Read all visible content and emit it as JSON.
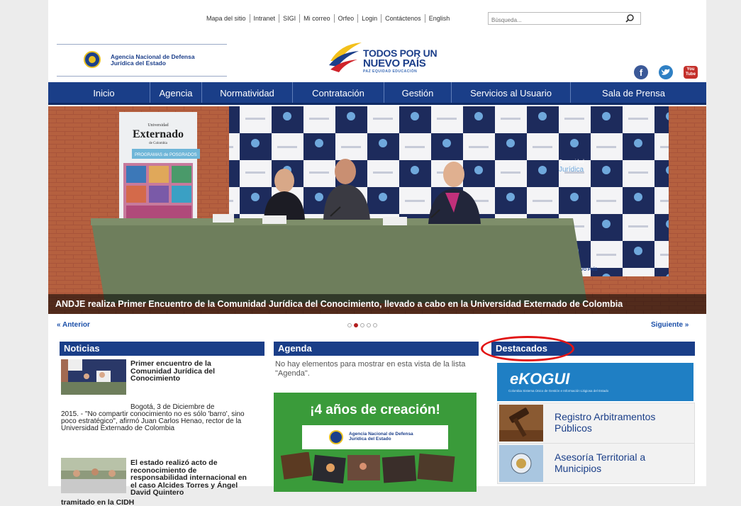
{
  "top_links": [
    "Mapa del sitio",
    "Intranet",
    "SIGI",
    "Mi correo",
    "Orfeo",
    "Login",
    "Contáctenos",
    "English"
  ],
  "search": {
    "placeholder": "Búsqueda..."
  },
  "logo": {
    "line1": "Agencia Nacional de Defensa",
    "line2": "Jurídica del Estado"
  },
  "gov_brand": {
    "line1": "TODOS POR UN",
    "line2": "NUEVO PAÍS",
    "tagline": "PAZ  EQUIDAD  EDUCACIÓN"
  },
  "social": {
    "facebook": "f",
    "twitter": "t",
    "youtube_line1": "You",
    "youtube_line2": "Tube"
  },
  "nav": [
    "Inicio",
    "Agencia",
    "Normatividad",
    "Contratación",
    "Gestión",
    "Servicios al Usuario",
    "Sala de Prensa"
  ],
  "hero": {
    "caption": "ANDJE realiza Primer Encuentro de la Comunidad Jurídica del Conocimiento, llevado a cabo en la Universidad Externado de Colombia",
    "banner_small": "Universidad",
    "banner_big": "Externado",
    "banner_sub": "de Colombia",
    "banner_prog": "PROGRAMAS de POSGRADOS",
    "backdrop_brand": "Comunidad",
    "backdrop_brand2": "Jurídica",
    "backdrop_tpun": "TODOS POR UN NUEVO PAÍS"
  },
  "slider": {
    "prev": "Anterior",
    "next": "Siguiente",
    "dot_count": 5,
    "active_index": 1
  },
  "noticias": {
    "heading": "Noticias",
    "items": [
      {
        "title": "Primer encuentro de la Comunidad Jurídica del Conocimiento",
        "date": "Bogotá, 3 de Diciembre de",
        "body": "2015. - \"No compartir conocimiento no es sólo 'barro', sino poco estratégico\", afirmó Juan Carlos Henao, rector de la Universidad Externado de Colombia"
      },
      {
        "title": "El estado realizó acto de reconocimiento de responsabilidad internacional en el caso Alcides Torres y Ángel David Quintero",
        "body": "tramitado en la CIDH"
      }
    ]
  },
  "agenda": {
    "heading": "Agenda",
    "empty_message": "No hay elementos para mostrar en esta vista de la lista \"Agenda\".",
    "promo_title": "¡4 años de creación!",
    "promo_logo_line1": "Agencia Nacional de Defensa",
    "promo_logo_line2": "Jurídica del Estado"
  },
  "destacados": {
    "heading": "Destacados",
    "ekogui_title": "eKOGUI",
    "ekogui_sub": "Colombia Sistema Único de Gestión e Información Litigiosa del Estado",
    "cards": [
      "Registro Arbitramentos Públicos",
      "Asesoría Territorial a Municipios"
    ]
  },
  "colors": {
    "nav_blue": "#1a3e88",
    "link_blue": "#1a4ea8",
    "highlight_red": "#e21414",
    "promo_green": "#3a9b3a"
  }
}
